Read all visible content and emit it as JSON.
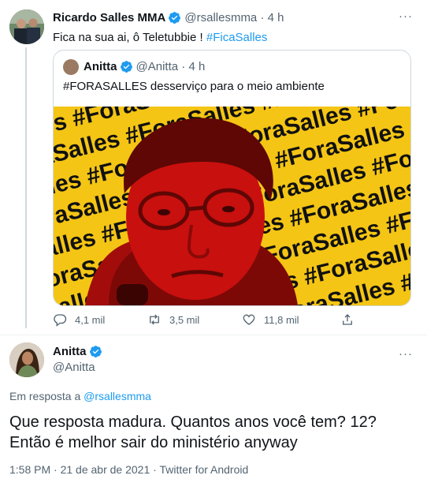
{
  "tweet": {
    "author": {
      "name": "Ricardo Salles MMA",
      "handle": "@rsallesmma",
      "time": "4 h"
    },
    "more_icon": "ellipsis-icon",
    "text_prefix": "Fica na sua ai, ô Teletubbie ! ",
    "hashtag": "#FicaSalles",
    "quoted": {
      "author": {
        "name": "Anitta",
        "handle": "@Anitta",
        "time": "4 h"
      },
      "text": "#FORASALLES desserviço para o meio ambiente",
      "image_repeat_text": "#ForaSalles"
    },
    "actions": {
      "reply_count": "4,1 mil",
      "retweet_count": "3,5 mil",
      "like_count": "11,8 mil",
      "share_icon": "share-icon"
    }
  },
  "reply_tweet": {
    "author": {
      "name": "Anitta",
      "handle": "@Anitta"
    },
    "replying_to_prefix": "Em resposta a ",
    "replying_to_handle": "@rsallesmma",
    "text": "Que resposta madura. Quantos anos você tem? 12? Então é melhor sair do ministério anyway",
    "meta": {
      "time": "1:58 PM",
      "sep1": " · ",
      "date": "21 de abr de 2021",
      "sep2": " · ",
      "source": "Twitter for Android"
    }
  },
  "colors": {
    "accent": "#1d9bf0",
    "muted": "#536471",
    "image_yellow": "#f4c514",
    "image_red": "#c8100e"
  }
}
